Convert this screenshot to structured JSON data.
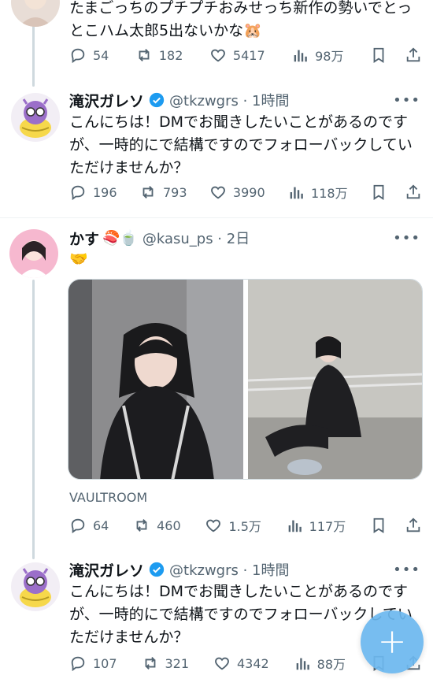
{
  "tweets": [
    {
      "text": "たまごっちのプチプチおみせっち新作の勢いでとっとこハム太郎5出ないかな🐹",
      "stats": {
        "replies": "54",
        "retweets": "182",
        "likes": "5417",
        "views": "98万"
      }
    },
    {
      "name": "滝沢ガレソ",
      "handle_time": "@tkzwgrs · 1時間",
      "text": "こんにちは！DMでお聞きしたいことがあるのですが、一時的にで結構ですのでフォローバックしていただけませんか？",
      "stats": {
        "replies": "196",
        "retweets": "793",
        "likes": "3990",
        "views": "118万"
      }
    },
    {
      "name": "かす",
      "name_emoji": "🍣🍵",
      "handle_time": "@kasu_ps · 2日",
      "text": "🤝",
      "card_domain": "VAULTROOM",
      "stats": {
        "replies": "64",
        "retweets": "460",
        "likes": "1.5万",
        "views": "117万"
      }
    },
    {
      "name": "滝沢ガレソ",
      "handle_time": "@tkzwgrs · 1時間",
      "text": "こんにちは！DMでお聞きしたいことがあるのですが、一時的にで結構ですのでフォローバックしていただけませんか？",
      "stats": {
        "replies": "107",
        "retweets": "321",
        "likes": "4342",
        "views": "88万"
      }
    }
  ],
  "more_label": "•••",
  "fab_label": "+",
  "colors": {
    "accent": "#1d9bf0",
    "muted": "#536471",
    "fab": "#6cb8ef"
  }
}
